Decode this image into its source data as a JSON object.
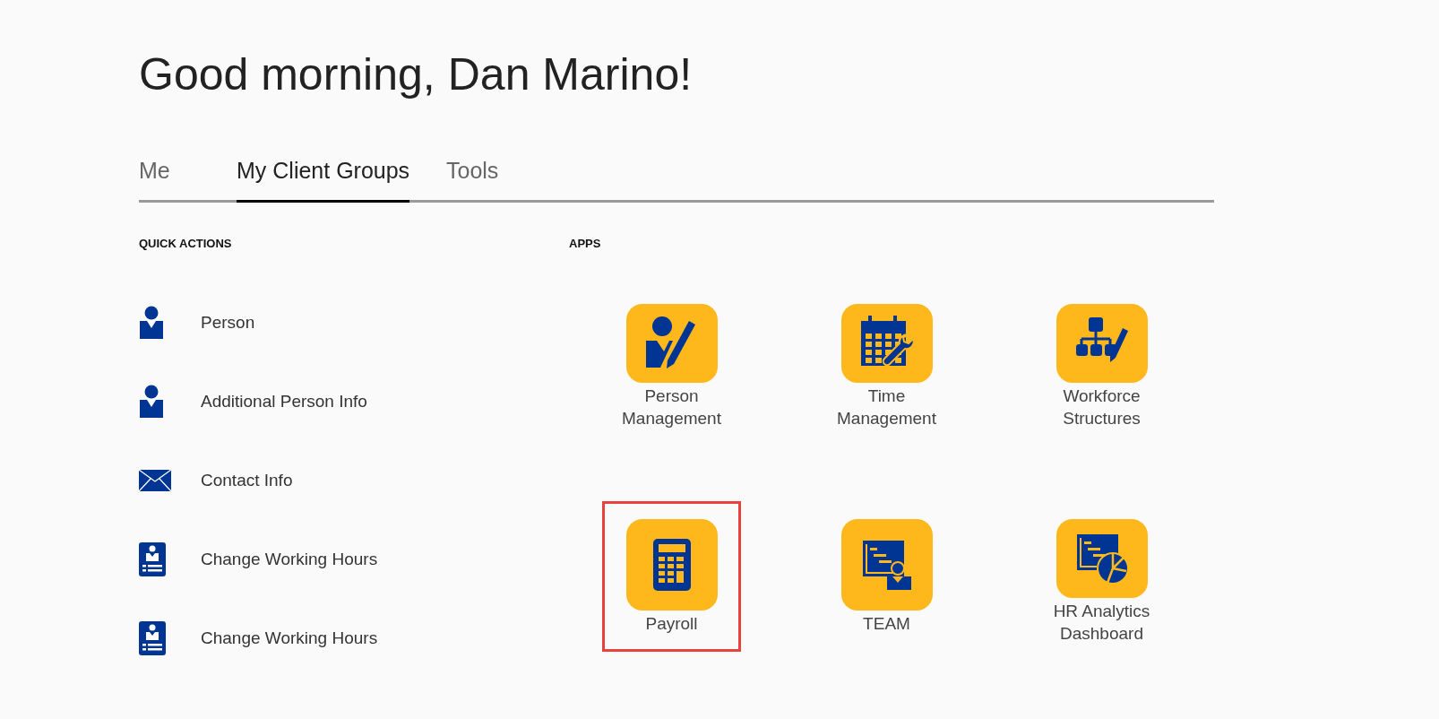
{
  "greeting": {
    "text": "Good morning,",
    "name": "Dan Marino!"
  },
  "tabs": [
    {
      "label": "Me",
      "selected": false
    },
    {
      "label": "My Client Groups",
      "selected": true
    },
    {
      "label": "Tools",
      "selected": false
    }
  ],
  "quick_actions": {
    "heading": "QUICK ACTIONS",
    "items": [
      {
        "kind": "person",
        "label": "Person"
      },
      {
        "kind": "person",
        "label": "Additional Person Info"
      },
      {
        "kind": "envelope",
        "label": "Contact Info"
      },
      {
        "kind": "badge",
        "label": "Change Working Hours"
      },
      {
        "kind": "badge",
        "label": "Change Working Hours"
      }
    ]
  },
  "apps": {
    "heading": "APPS",
    "items": [
      {
        "kind": "person-edit",
        "label": [
          "Person",
          "Management"
        ],
        "highlighted": false
      },
      {
        "kind": "calendar-wrench",
        "label": [
          "Time",
          "Management"
        ],
        "highlighted": false
      },
      {
        "kind": "org-chart",
        "label": [
          "Workforce",
          "Structures"
        ],
        "highlighted": false
      },
      {
        "kind": "calculator",
        "label": [
          "Payroll"
        ],
        "highlighted": true
      },
      {
        "kind": "team-report",
        "label": [
          "TEAM"
        ],
        "highlighted": false
      },
      {
        "kind": "analytics",
        "label": [
          "HR Analytics",
          "Dashboard"
        ],
        "highlighted": false
      }
    ]
  }
}
